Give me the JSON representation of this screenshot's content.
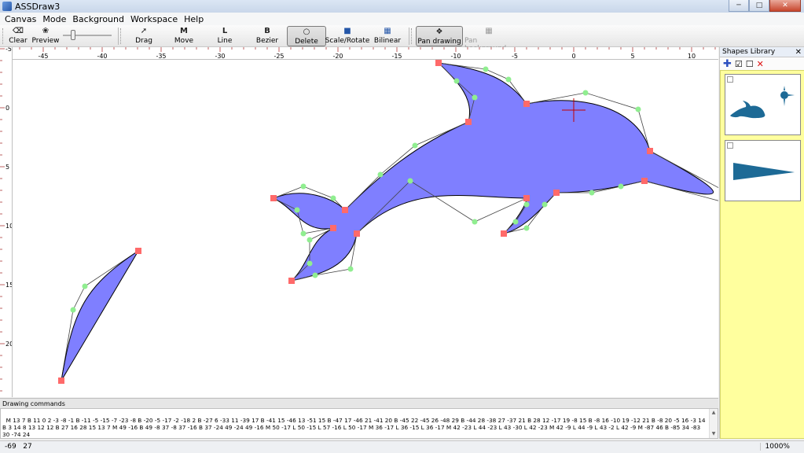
{
  "window": {
    "title": "ASSDraw3"
  },
  "menu": [
    "Canvas",
    "Mode",
    "Background",
    "Workspace",
    "Help"
  ],
  "toolbar": {
    "clear": "Clear",
    "preview": "Preview",
    "drag": "Drag",
    "move": "Move",
    "line": "Line",
    "bezier": "Bezier",
    "delete": "Delete",
    "scale_rotate": "Scale/Rotate",
    "bilinear": "Bilinear",
    "pan_drawing": "Pan drawing",
    "pan_background": "Pan background",
    "move_icon_glyph": "M",
    "line_icon_glyph": "L",
    "bezier_icon_glyph": "B",
    "preview_zoom_fraction": 0.18,
    "active_tool": "delete"
  },
  "shapes_library": {
    "title": "Shapes Library"
  },
  "drawing_commands": {
    "label": "Drawing commands",
    "text": "M 13 7 B 11 0 2 -3 -8 -1 B -11 -5 -15 -7 -23 -8 B -20 -5 -17 -2 -18 2 B -27 6 -33 11 -39 17 B -41 15 -46 13 -51 15 B -47 17 -46 21 -41 20 B -45 22 -45 26 -48 29 B -44 28 -38 27 -37 21 B 28 12 -17 19 -8 15 B -8 16 -10 19 -12 21 B -8 20 -5 16 -3 14 B 3 14 8 13 12 12 B 27 16 28 15 13 7 M 49 -16 B 49 -8 37 -8 37 -16 B 37 -24 49 -24 49 -16 M 50 -17 L 50 -15 L 57 -16 L 50 -17 M 36 -17 L 36 -15 L 36 -17 M 42 -23 L 44 -23 L 43 -30 L 42 -23 M 42 -9 L 44 -9 L 43 -2 L 42 -9 M -87 46 B -85 34 -83 30 -74 24"
  },
  "status": {
    "x": "-69",
    "y": "27",
    "zoom": "1000%"
  },
  "colors": {
    "shape_fill": "#7f7fff",
    "library_bg": "#ffff9e",
    "library_shape": "#1d6a96",
    "control_point": "#90ee90",
    "vertex_point": "#ff6a6a",
    "ruler_tick": "#a02020",
    "crosshair": "#c00000"
  },
  "icons": [
    "clear-icon",
    "preview-icon",
    "drag-icon",
    "move-icon",
    "line-icon",
    "bezier-icon",
    "delete-icon",
    "scale-rotate-icon",
    "bilinear-icon",
    "pan-drawing-icon",
    "pan-background-icon"
  ]
}
